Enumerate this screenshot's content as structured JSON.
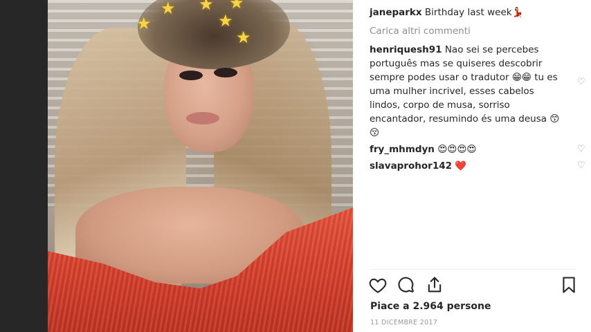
{
  "post": {
    "author": "janeparkx",
    "caption": "Birthday last week💃🏻",
    "load_more": "Carica altri commenti"
  },
  "comments": [
    {
      "user": "henriquesh91",
      "text": "Nao sei se percebes português mas se quiseres descobrir sempre podes usar o tradutor 😁😁 tu es uma mulher incrivel, esses cabelos lindos, corpo de musa, sorriso encantador, resumindo és uma deusa 😙😚"
    },
    {
      "user": "fry_mhmdyn",
      "text": "😍😍😍😍"
    },
    {
      "user": "slavaprohor142",
      "text": "❤️"
    }
  ],
  "engagement": {
    "likes": "Piace a 2.964 persone",
    "date": "11 DICEMBRE 2017"
  },
  "icons": {
    "like": "heart-outline-icon",
    "comment": "speech-bubble-icon",
    "share": "share-icon",
    "save": "bookmark-icon",
    "comment_like": "heart-small-icon"
  },
  "colors": {
    "panel_bg": "#ffffff",
    "muted": "#8e8e8e",
    "text": "#262626",
    "dress": "#d8402c",
    "sticker_star": "#f5d44a"
  }
}
